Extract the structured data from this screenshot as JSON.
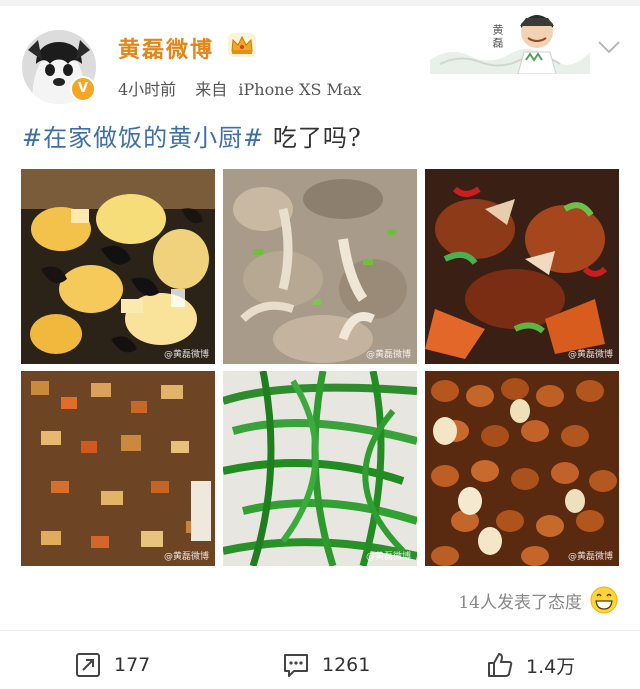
{
  "post": {
    "username": "黄磊微博",
    "time": "4小时前",
    "source_prefix": "来自",
    "device": "iPhone XS Max",
    "card_name": "黄磊",
    "topic": "#在家做饭的黄小厨#",
    "text": " 吃了吗?",
    "watermarks": [
      "@黄磊微博",
      "@黄磊微博",
      "@黄磊微博",
      "@黄磊微博",
      "@黄磊微博",
      "@黄磊微博"
    ]
  },
  "reactions": {
    "summary": "14人发表了态度"
  },
  "actions": {
    "reposts": "177",
    "comments": "1261",
    "likes": "1.4万"
  },
  "colors": {
    "username": "#e0861a",
    "topic": "#3f6fa6",
    "verified": "#f5a623",
    "text": "#333333"
  },
  "icons": [
    "verified-badge-icon",
    "crown-icon",
    "chevron-down-icon",
    "grin-emoji-icon",
    "repost-icon",
    "comment-icon",
    "like-icon"
  ]
}
